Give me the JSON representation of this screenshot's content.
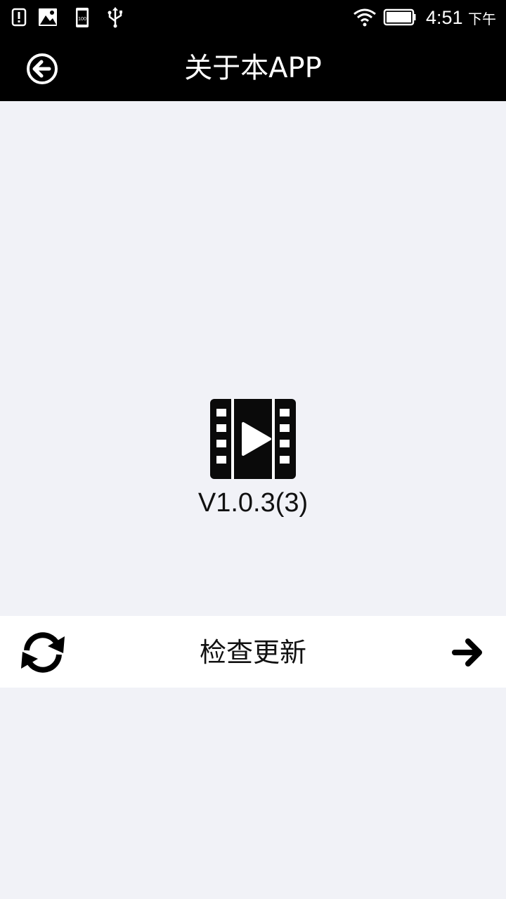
{
  "status_bar": {
    "time": "4:51",
    "ampm": "下午",
    "icons": [
      "alert-icon",
      "image-icon",
      "sd-card-icon",
      "usb-icon",
      "wifi-icon",
      "battery-icon"
    ]
  },
  "app_bar": {
    "title": "关于本APP",
    "back_icon": "back-arrow-circle-icon"
  },
  "app_info": {
    "logo_icon": "film-play-icon",
    "version": "V1.0.3(3)"
  },
  "update_row": {
    "label": "检查更新",
    "left_icon": "refresh-icon",
    "right_icon": "arrow-right-icon"
  },
  "colors": {
    "bar_background": "#000000",
    "page_background": "#f1f2f7",
    "row_background": "#ffffff"
  }
}
